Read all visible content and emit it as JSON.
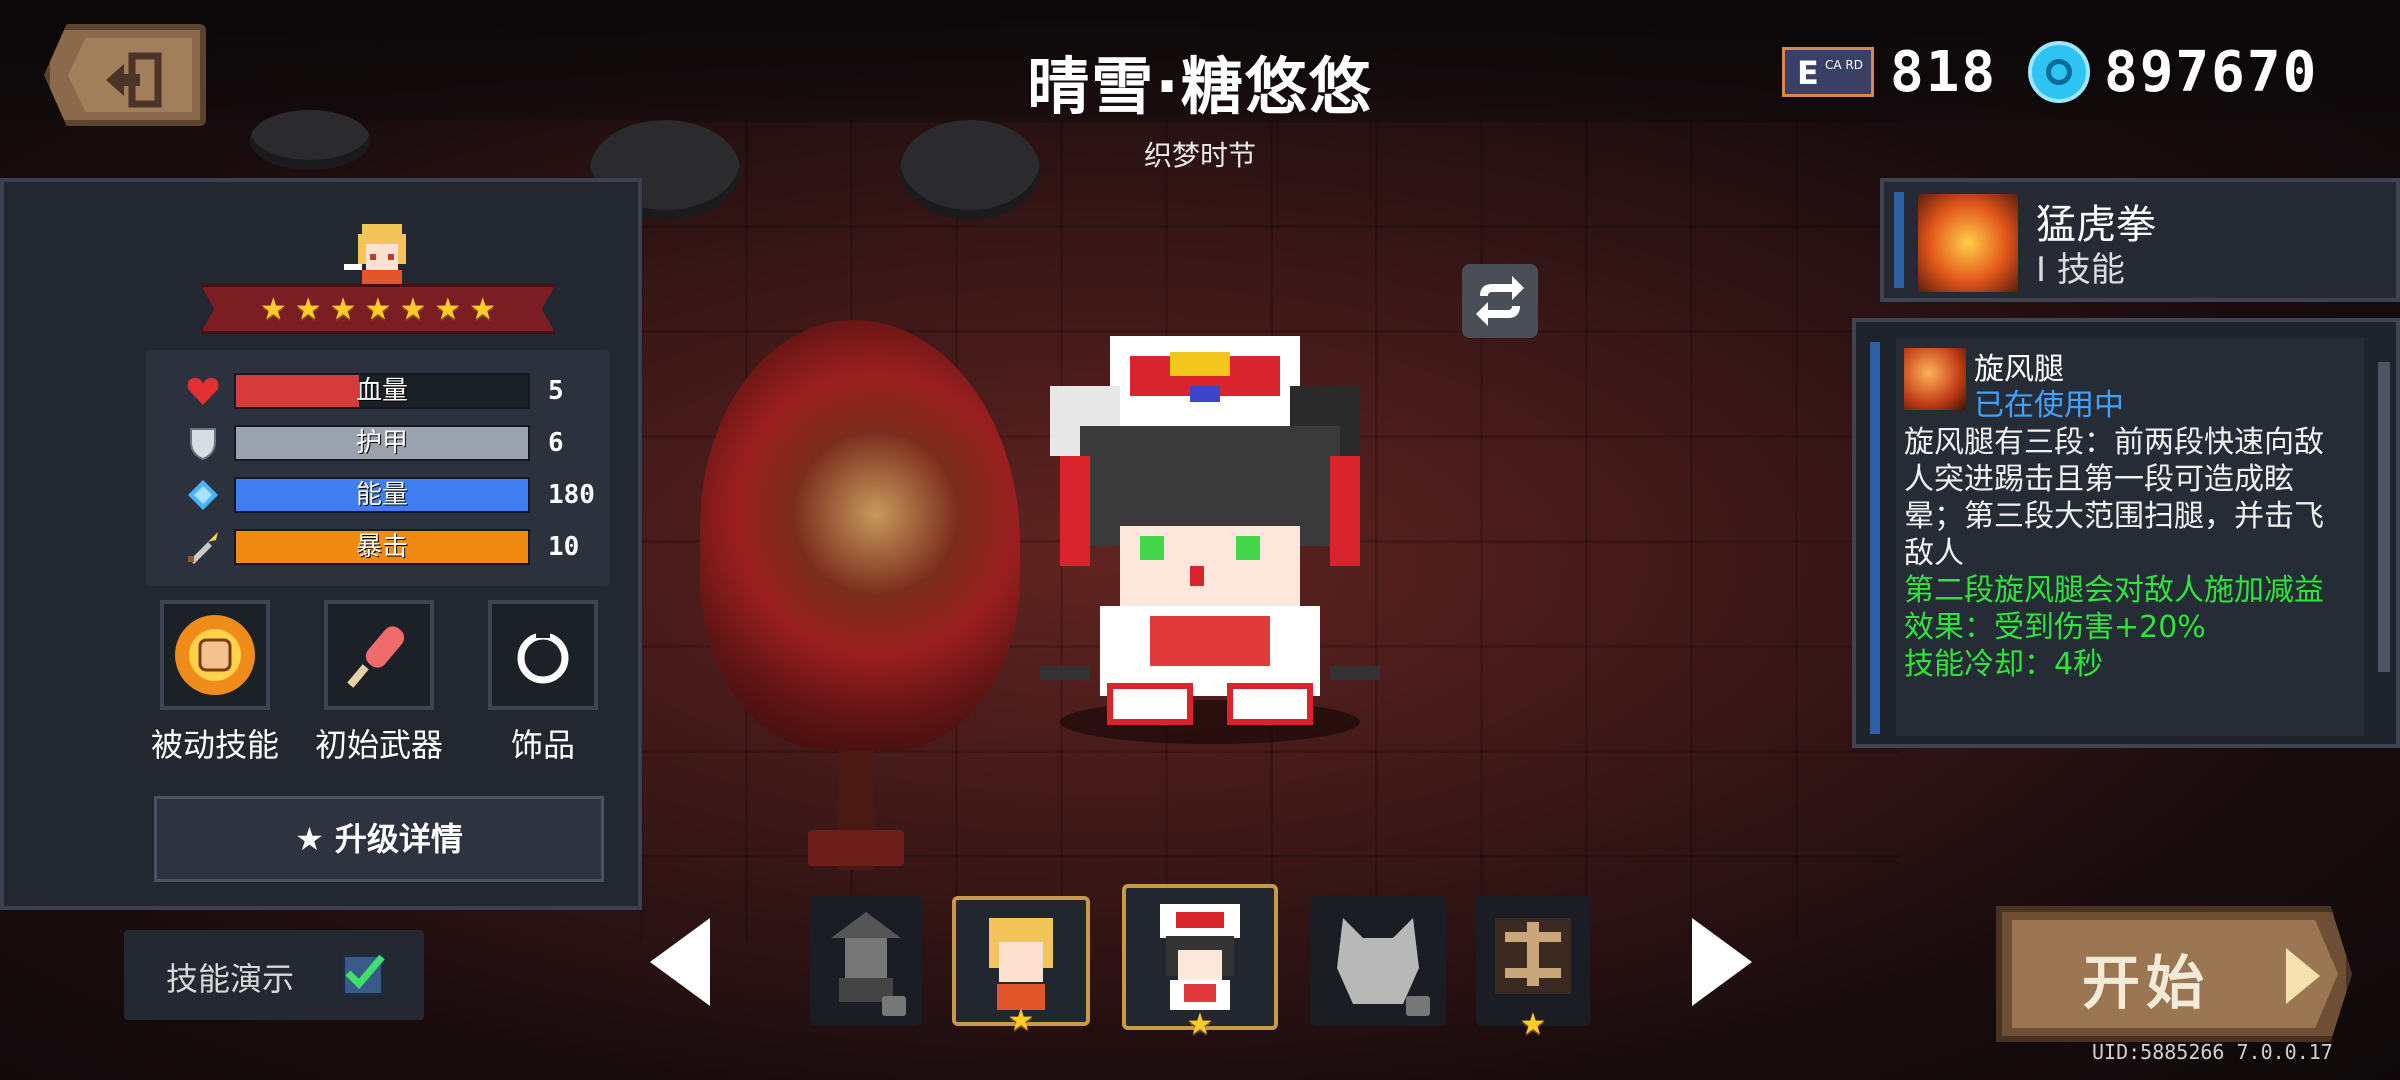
{
  "header": {
    "title": "晴雪·糖悠悠",
    "subtitle": "织梦时节",
    "card_icon_letter": "E",
    "card_icon_small": "CA RD",
    "card_count": "818",
    "gem_count": "897670"
  },
  "hero_info": {
    "stars": [
      "★",
      "★",
      "★",
      "★",
      "★",
      "★",
      "★"
    ],
    "stats": [
      {
        "icon": "heart-icon",
        "label": "血量",
        "value": "5",
        "fill": 0.42,
        "color": "#d63a3a"
      },
      {
        "icon": "shield-icon",
        "label": "护甲",
        "value": "6",
        "fill": 1.0,
        "color": "#9aa3ad"
      },
      {
        "icon": "crystal-icon",
        "label": "能量",
        "value": "180",
        "fill": 1.0,
        "color": "#3f7df0"
      },
      {
        "icon": "dagger-icon",
        "label": "暴击",
        "value": "10",
        "fill": 1.0,
        "color": "#f18a12"
      }
    ],
    "slots": [
      {
        "label": "被动技能",
        "icon": "fist-icon"
      },
      {
        "label": "初始武器",
        "icon": "popsicle-weapon-icon"
      },
      {
        "label": "饰品",
        "icon": "ring-icon"
      }
    ],
    "upgrade_label": "★ 升级详情",
    "demo_label": "技能演示",
    "demo_checked": true
  },
  "skill": {
    "name": "猛虎拳",
    "level": "Ⅰ 技能",
    "detail_name": "旋风腿",
    "detail_state": "已在使用中",
    "description": "旋风腿有三段：前两段快速向敌人突进踢击且第一段可造成眩晕；第三段大范围扫腿，并击飞敌人",
    "bonus": "第二段旋风腿会对敌人施加减益效果：受到伤害+20%",
    "cooldown": "技能冷却：4秒"
  },
  "selector": {
    "heroes": [
      {
        "name": "witch-hero",
        "selected": false,
        "locked": true,
        "star": false
      },
      {
        "name": "blonde-hero",
        "selected": true,
        "locked": false,
        "star": true
      },
      {
        "name": "lion-dance-hero",
        "selected": true,
        "locked": false,
        "star": true,
        "current": true
      },
      {
        "name": "wolf-hero",
        "selected": false,
        "locked": true,
        "star": false
      },
      {
        "name": "martial-hero",
        "selected": false,
        "locked": false,
        "star": true
      }
    ]
  },
  "start_label": "开始",
  "footer": {
    "uid": "UID:5885266 7.0.0.17"
  }
}
